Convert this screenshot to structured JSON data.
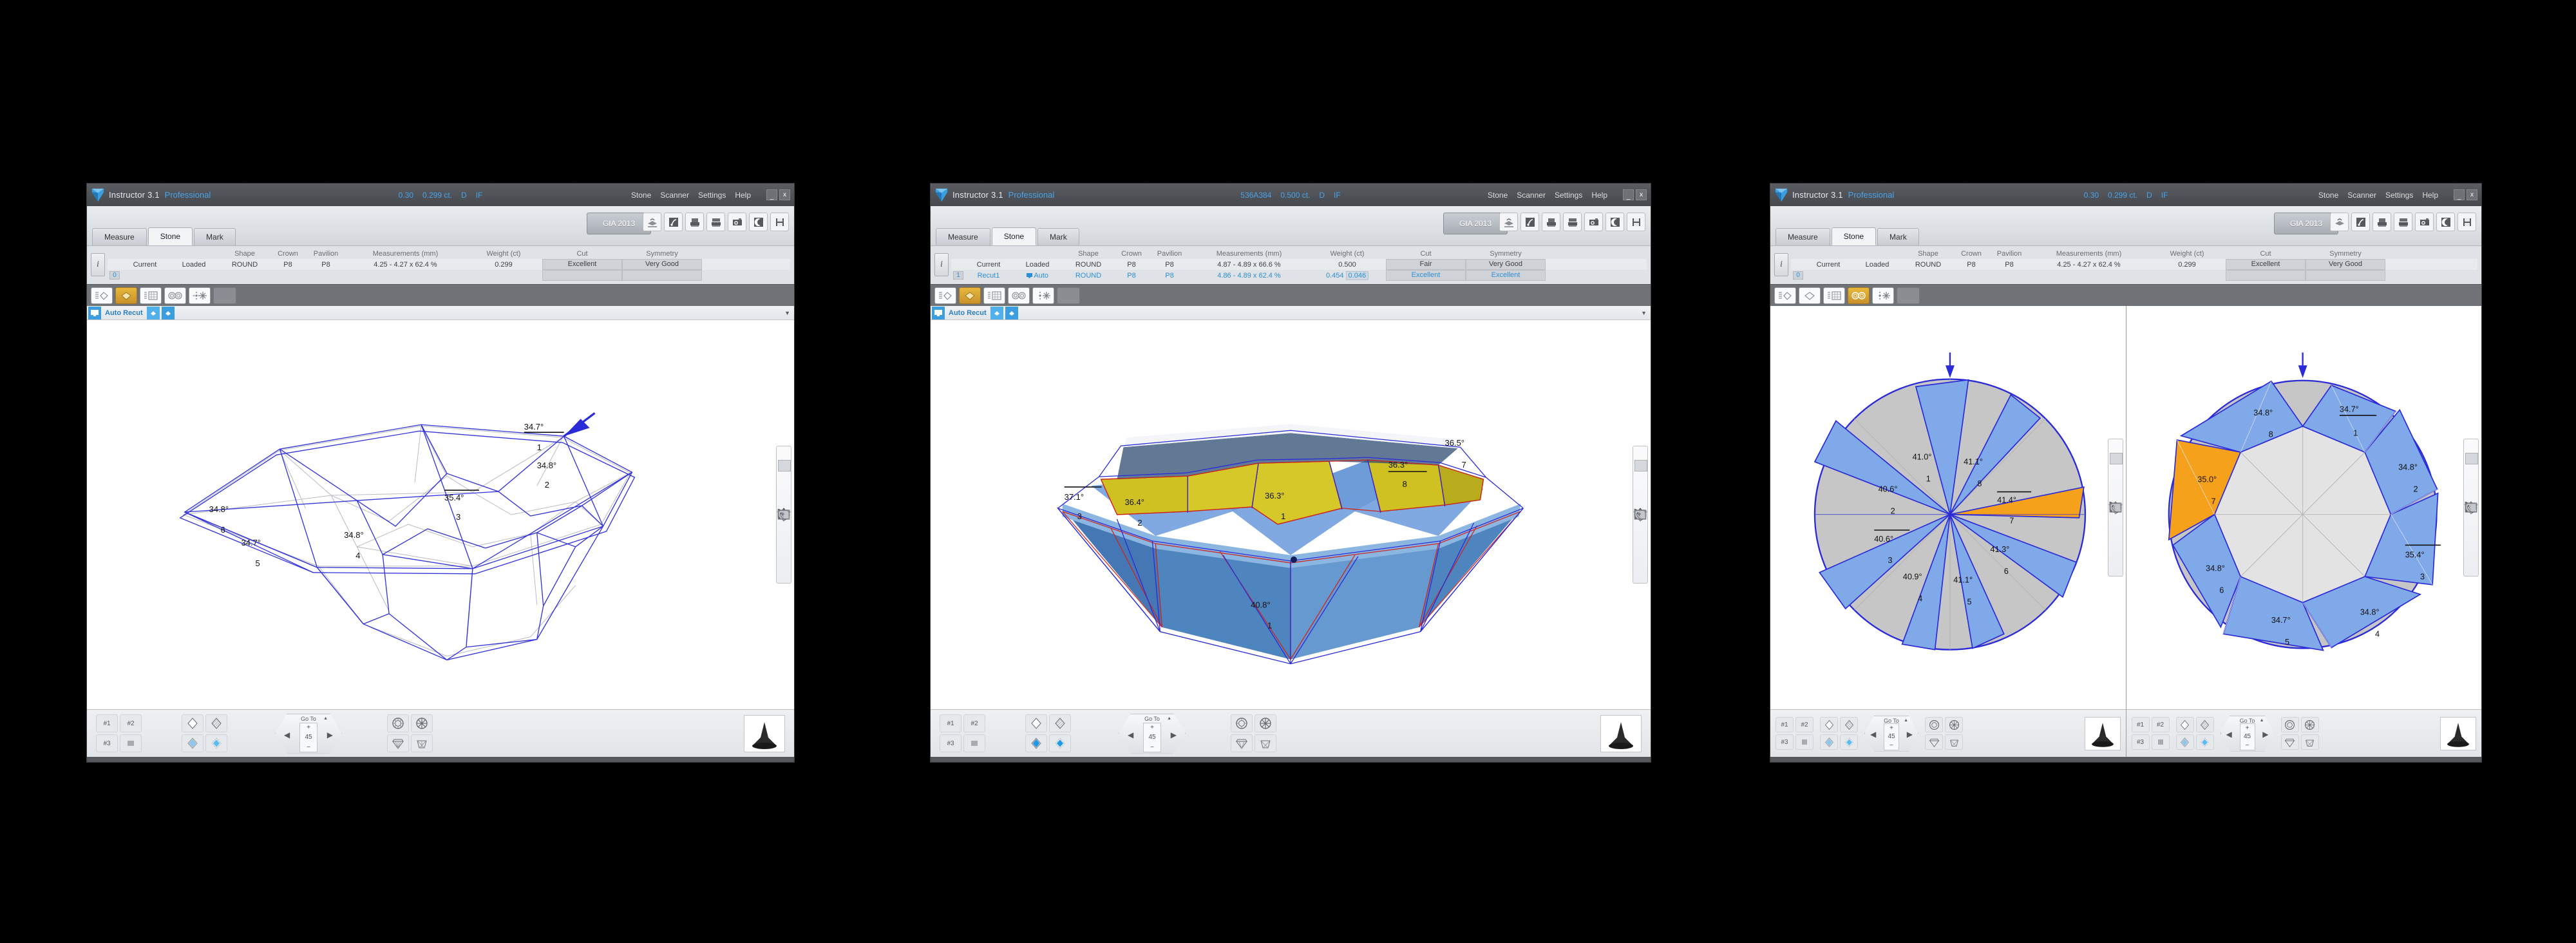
{
  "app": {
    "name": "Instructor 3.1",
    "edition": "Professional",
    "logo_icon": "diamond-logo-icon",
    "menus": [
      "Stone",
      "Scanner",
      "Settings",
      "Help"
    ],
    "window_buttons": [
      "_",
      "x"
    ]
  },
  "tabs": [
    {
      "label": "Measure",
      "active": false
    },
    {
      "label": "Stone",
      "active": true
    },
    {
      "label": "Mark",
      "active": false
    }
  ],
  "standard_button": "GIA 2013",
  "header_icons": [
    "load-stone-icon",
    "scan-icon",
    "print-icon",
    "report-icon",
    "camera-icon",
    "contrast-icon",
    "save-icon"
  ],
  "grid": {
    "columns": [
      "",
      "",
      "",
      "Shape",
      "Crown",
      "Pavilion",
      "Measurements (mm)",
      "Weight (ct)",
      "Cut",
      "Symmetry"
    ],
    "info_icon": "info-icon"
  },
  "mode_toolbar": {
    "icons": [
      "list-shape-icon",
      "shape-icon",
      "table-list-icon",
      "two-circles-icon",
      "sparkle-icon",
      "blank-icon"
    ]
  },
  "panel": {
    "title": "Auto Recut",
    "monitor_icon": "monitor-icon",
    "buttons": [
      "recut-icon-1",
      "recut-icon-2"
    ],
    "collapse_icon": "chevron-down-icon"
  },
  "vertical_tools": [
    "cursor-arrow-icon",
    "select-rake-icon",
    "crosshair-circle-icon",
    "half-fill-icon",
    "dot-circle-icon",
    "pavilion-icon",
    "half-circle-icon",
    "ribbon-icon",
    "two-diamonds-icon",
    "circle-icon",
    "fit-screen-icon"
  ],
  "bottom_toolbar": {
    "preset_labels": [
      "#1",
      "#2",
      "#3",
      "lines-icon"
    ],
    "view_icons": [
      "outline-diamond-icon",
      "hatched-diamond-icon",
      "shaded-diamond-icon",
      "filled-diamond-icon"
    ],
    "goto_label": "Go To",
    "goto_value": "45",
    "goto_plus": "+",
    "goto_minus": "−",
    "goto_left_icon": "arrow-left-icon",
    "goto_right_icon": "arrow-right-icon",
    "goto_caret_icon": "caret-up-icon",
    "shape_icons": [
      "round-top-icon",
      "asterisk-icon",
      "brilliant-side-icon",
      "pavilion-side-icon"
    ],
    "thumbnail_icon": "stone-thumbnail-icon"
  },
  "windows": [
    {
      "id": "win1",
      "stone_id": "0.30",
      "stone_weight": "0.299 ct.",
      "stone_color": "D",
      "stone_clarity": "IF",
      "active_mode_index": 1,
      "rows": [
        {
          "idx": "",
          "name": "Current",
          "mode": "Loaded",
          "shape": "ROUND",
          "crown": "P8",
          "pavilion": "P8",
          "meas": "4.25 - 4.27 x 62.4 %",
          "weight": "0.299",
          "weight_delta": "",
          "cut": "Excellent",
          "sym": "Very Good",
          "highlight": false
        },
        {
          "idx": "0",
          "name": "",
          "mode": "",
          "shape": "",
          "crown": "",
          "pavilion": "",
          "meas": "",
          "weight": "",
          "weight_delta": "",
          "cut": "",
          "sym": "",
          "highlight": false
        }
      ],
      "view": "wireframe-side",
      "labels": [
        {
          "angle": "34.7°",
          "num": "1",
          "underline": true
        },
        {
          "angle": "34.8°",
          "num": "2",
          "underline": false
        },
        {
          "angle": "35.4°",
          "num": "3",
          "underline": true
        },
        {
          "angle": "34.8°",
          "num": "4",
          "underline": false
        },
        {
          "angle": "34.7°",
          "num": "5",
          "underline": false
        },
        {
          "angle": "34.8°",
          "num": "6",
          "underline": false
        }
      ]
    },
    {
      "id": "win2",
      "stone_id": "536A384",
      "stone_weight": "0.500 ct.",
      "stone_color": "D",
      "stone_clarity": "IF",
      "active_mode_index": 1,
      "rows": [
        {
          "idx": "",
          "name": "Current",
          "mode": "Loaded",
          "shape": "ROUND",
          "crown": "P8",
          "pavilion": "P8",
          "meas": "4.87 - 4.89 x 66.6 %",
          "weight": "0.500",
          "weight_delta": "",
          "cut": "Fair",
          "sym": "Very Good",
          "highlight": false
        },
        {
          "idx": "1",
          "name": "Recut1",
          "mode": "Auto",
          "shape": "ROUND",
          "crown": "P8",
          "pavilion": "P8",
          "meas": "4.86 - 4.89 x 62.4 %",
          "weight": "0.454",
          "weight_delta": "0.046",
          "cut": "Excellent",
          "sym": "Excellent",
          "highlight": true
        }
      ],
      "view": "solid-side",
      "labels": [
        {
          "angle": "37.1°",
          "num": "3",
          "underline": true
        },
        {
          "angle": "36.4°",
          "num": "2",
          "underline": false
        },
        {
          "angle": "36.3°",
          "num": "1",
          "underline": false
        },
        {
          "angle": "36.3°",
          "num": "8",
          "underline": true
        },
        {
          "angle": "36.5°",
          "num": "7",
          "underline": false
        },
        {
          "angle": "40.8°",
          "num": "1",
          "underline": false
        }
      ]
    },
    {
      "id": "win3",
      "stone_id": "0.30",
      "stone_weight": "0.299 ct.",
      "stone_color": "D",
      "stone_clarity": "IF",
      "active_mode_index": 3,
      "rows": [
        {
          "idx": "",
          "name": "Current",
          "mode": "Loaded",
          "shape": "ROUND",
          "crown": "P8",
          "pavilion": "P8",
          "meas": "4.25 - 4.27 x 62.4 %",
          "weight": "0.299",
          "weight_delta": "",
          "cut": "Excellent",
          "sym": "Very Good",
          "highlight": false
        },
        {
          "idx": "0",
          "name": "",
          "mode": "",
          "shape": "",
          "crown": "",
          "pavilion": "",
          "meas": "",
          "weight": "",
          "weight_delta": "",
          "cut": "",
          "sym": "",
          "highlight": false
        }
      ],
      "view": "two-top-views"
    }
  ],
  "chart_data": [
    {
      "type": "radial-facet-map",
      "title": "Pavilion main facets — top view (left circle, window 3)",
      "facet_kind": "pavilion",
      "highlight_color": "#f5a11c",
      "facet_color": "#7fa9e8",
      "base_color": "#c6c6c6",
      "categories": [
        "1",
        "2",
        "3",
        "4",
        "5",
        "6",
        "7",
        "8"
      ],
      "values": [
        41.0,
        40.6,
        40.6,
        40.9,
        41.1,
        41.3,
        41.4,
        41.1
      ],
      "unit": "degrees",
      "labels": [
        {
          "num": "1",
          "angle": "41.0°",
          "underline": false,
          "highlight": false
        },
        {
          "num": "2",
          "angle": "40.6°",
          "underline": false,
          "highlight": false
        },
        {
          "num": "3",
          "angle": "40.6°",
          "underline": true,
          "highlight": false
        },
        {
          "num": "4",
          "angle": "40.9°",
          "underline": false,
          "highlight": false
        },
        {
          "num": "5",
          "angle": "41.1°",
          "underline": false,
          "highlight": false
        },
        {
          "num": "6",
          "angle": "41.3°",
          "underline": false,
          "highlight": false
        },
        {
          "num": "7",
          "angle": "41.4°",
          "underline": true,
          "highlight": true
        },
        {
          "num": "8",
          "angle": "41.1°",
          "underline": false,
          "highlight": false
        }
      ]
    },
    {
      "type": "radial-facet-map",
      "title": "Crown bezel facets — top view (right circle, window 3)",
      "facet_kind": "crown",
      "highlight_color": "#f5a11c",
      "facet_color": "#7fa9e8",
      "base_color": "#c6c6c6",
      "categories": [
        "1",
        "2",
        "3",
        "4",
        "5",
        "6",
        "7",
        "8"
      ],
      "values": [
        34.7,
        34.8,
        35.4,
        34.8,
        34.7,
        34.8,
        35.0,
        34.8
      ],
      "unit": "degrees",
      "labels": [
        {
          "num": "1",
          "angle": "34.7°",
          "underline": true,
          "highlight": false
        },
        {
          "num": "2",
          "angle": "34.8°",
          "underline": false,
          "highlight": false
        },
        {
          "num": "3",
          "angle": "35.4°",
          "underline": true,
          "highlight": false
        },
        {
          "num": "4",
          "angle": "34.8°",
          "underline": false,
          "highlight": false
        },
        {
          "num": "5",
          "angle": "34.7°",
          "underline": false,
          "highlight": false
        },
        {
          "num": "6",
          "angle": "34.8°",
          "underline": false,
          "highlight": false
        },
        {
          "num": "7",
          "angle": "35.0°",
          "underline": false,
          "highlight": true
        },
        {
          "num": "8",
          "angle": "34.8°",
          "underline": false,
          "highlight": false
        }
      ]
    },
    {
      "type": "facet-angle-callouts",
      "title": "Crown facet angles — wireframe side view (window 1)",
      "categories": [
        "1",
        "2",
        "3",
        "4",
        "5",
        "6"
      ],
      "values": [
        34.7,
        34.8,
        35.4,
        34.8,
        34.7,
        34.8
      ],
      "unit": "degrees"
    },
    {
      "type": "facet-angle-callouts",
      "title": "Recut facet angles — solid side view (window 2)",
      "categories": [
        "3",
        "2",
        "1",
        "8",
        "7",
        "pavilion-1"
      ],
      "values": [
        37.1,
        36.4,
        36.3,
        36.3,
        36.5,
        40.8
      ],
      "unit": "degrees"
    }
  ]
}
